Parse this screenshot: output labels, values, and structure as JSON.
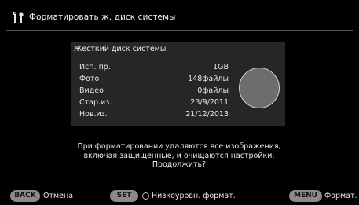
{
  "header": {
    "title": "Форматировать ж. диск системы",
    "icon": "tools-icon"
  },
  "panel": {
    "title": "Жесткий диск системы",
    "rows": [
      {
        "label": "Исп. пр.",
        "value": "1GB"
      },
      {
        "label": "Фото",
        "value": "148файлы"
      },
      {
        "label": "Видео",
        "value": "0файлы"
      },
      {
        "label": "Стар.из.",
        "value": "23/9/2011"
      },
      {
        "label": "Нов.из.",
        "value": "21/12/2013"
      }
    ]
  },
  "message": {
    "line1": "При форматировании удаляются все изображения,",
    "line2": "включая защищенные, и очищаются настройки.",
    "line3": "Продолжить?"
  },
  "footer": {
    "back_key": "BACK",
    "back_label": "Отмена",
    "set_key": "SET",
    "set_label": "Низкоуровн. формат.",
    "menu_key": "MENU",
    "menu_label": "Формат."
  },
  "colors": {
    "background": "#000000",
    "panel": "#262626",
    "key": "#8a8a8a",
    "disk": "#6d6d6d"
  }
}
